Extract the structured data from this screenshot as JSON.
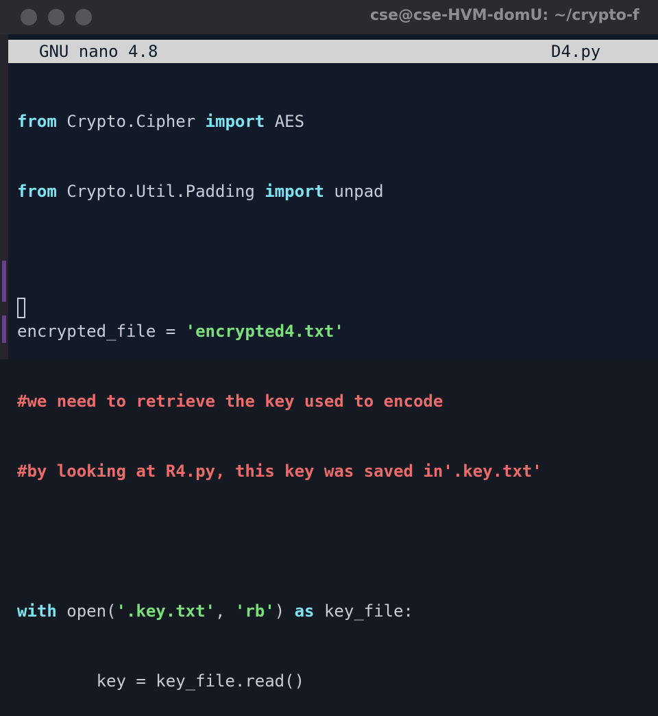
{
  "window": {
    "title": "cse@cse-HVM-domU: ~/crypto-f"
  },
  "nano": {
    "version": "GNU nano 4.8",
    "filename": "D4.py"
  },
  "code": {
    "l1": {
      "kw1": "from",
      "mod": " Crypto.Cipher ",
      "kw2": "import",
      "name": " AES"
    },
    "l2": {
      "kw1": "from",
      "mod": " Crypto.Util.Padding ",
      "kw2": "import",
      "name": " unpad"
    },
    "l4": {
      "var": "encrypted_file = ",
      "str": "'encrypted4.txt'"
    },
    "l5": {
      "comment": "#we need to retrieve the key used to encode"
    },
    "l6": {
      "comment": "#by looking at R4.py, this key was saved in'.key.txt'"
    },
    "l8": {
      "kw1": "with",
      "open": " open(",
      "str1": "'.key.txt'",
      "comma": ", ",
      "str2": "'rb'",
      "close": ") ",
      "kw2": "as",
      "rest": " key_file:"
    },
    "l9": {
      "text": "        key = key_file.read()"
    }
  },
  "colors": {
    "keyword": "#7fe4f2",
    "string": "#7be07b",
    "comment": "#ee6b6b",
    "text": "#c7ccd6",
    "background": "#121a2a"
  }
}
